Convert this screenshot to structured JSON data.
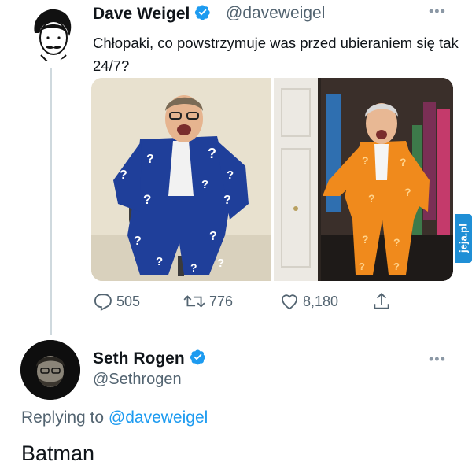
{
  "tweet": {
    "author_name": "Dave Weigel",
    "author_handle": "@daveweigel",
    "text": "Chłopaki, co powstrzymuje was przed ubieraniem się tak 24/7?",
    "stats": {
      "replies": "505",
      "retweets": "776",
      "likes": "8,180"
    },
    "media_alt": [
      "Man in blue suit covered with question marks sitting on a chair",
      "Man in orange suit covered with question marks standing in a closet"
    ]
  },
  "reply": {
    "author_name": "Seth Rogen",
    "author_handle": "@Sethrogen",
    "replying_prefix": "Replying to",
    "replying_to": "@daveweigel",
    "text": "Batman"
  },
  "icons": {
    "more": "more-icon",
    "verified": "verified-badge-icon",
    "reply": "reply-icon",
    "retweet": "retweet-icon",
    "like": "like-icon",
    "share": "share-icon"
  },
  "colors": {
    "verified_blue": "#1d9bf0",
    "mention_blue": "#1d9bf0",
    "secondary_text": "#536471",
    "thread_line": "#cfd9de"
  },
  "watermark": "jeja.pl"
}
